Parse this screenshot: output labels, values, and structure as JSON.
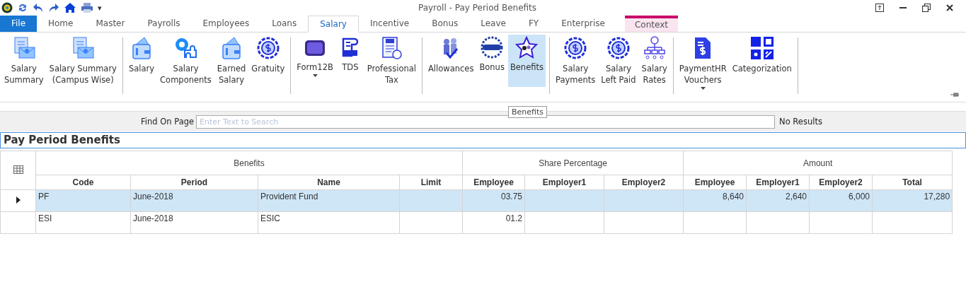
{
  "window": {
    "title": "Payroll - Pay Period Benefits",
    "quick_access_more": "▾"
  },
  "tabs": [
    {
      "label": "File",
      "kind": "file",
      "selected": false
    },
    {
      "label": "Home",
      "kind": "tab",
      "selected": false
    },
    {
      "label": "Master",
      "kind": "tab",
      "selected": false
    },
    {
      "label": "Payrolls",
      "kind": "tab",
      "selected": false
    },
    {
      "label": "Employees",
      "kind": "tab",
      "selected": false
    },
    {
      "label": "Loans",
      "kind": "tab",
      "selected": false
    },
    {
      "label": "Salary",
      "kind": "tab",
      "selected": true
    },
    {
      "label": "Incentive",
      "kind": "tab",
      "selected": false
    },
    {
      "label": "Bonus",
      "kind": "tab",
      "selected": false
    },
    {
      "label": "Leave",
      "kind": "tab",
      "selected": false
    },
    {
      "label": "FY",
      "kind": "tab",
      "selected": false
    },
    {
      "label": "Enterprise",
      "kind": "tab",
      "selected": false
    },
    {
      "label": "Context",
      "kind": "context",
      "selected": false
    }
  ],
  "ribbon_groups": [
    {
      "items": [
        {
          "lines": [
            "Salary",
            "Summary"
          ],
          "kind": "docmail",
          "selected": false,
          "dropdown": false
        },
        {
          "lines": [
            "Salary Summary",
            "(Campus Wise)"
          ],
          "kind": "docmail",
          "selected": false,
          "dropdown": false
        }
      ]
    },
    {
      "items": [
        {
          "lines": [
            "Salary"
          ],
          "kind": "wallet",
          "selected": false,
          "dropdown": false
        },
        {
          "lines": [
            "Salary",
            "Components"
          ],
          "kind": "gear",
          "selected": false,
          "dropdown": false
        },
        {
          "lines": [
            "Earned",
            "Salary"
          ],
          "kind": "wallet",
          "selected": false,
          "dropdown": false
        },
        {
          "lines": [
            "Gratuity"
          ],
          "kind": "money",
          "selected": false,
          "dropdown": false
        }
      ]
    },
    {
      "items": [
        {
          "lines": [
            "Form12B"
          ],
          "kind": "badge",
          "selected": false,
          "dropdown": true
        },
        {
          "lines": [
            "TDS"
          ],
          "kind": "tds",
          "selected": false,
          "dropdown": false
        },
        {
          "lines": [
            "Professional",
            "Tax"
          ],
          "kind": "taxdoc",
          "selected": false,
          "dropdown": false
        }
      ]
    },
    {
      "items": [
        {
          "lines": [
            "Allowances"
          ],
          "kind": "people",
          "selected": false,
          "dropdown": false
        },
        {
          "lines": [
            "Bonus"
          ],
          "kind": "bonus",
          "selected": false,
          "dropdown": false
        },
        {
          "lines": [
            "Benefits"
          ],
          "kind": "star",
          "selected": true,
          "dropdown": false
        }
      ]
    },
    {
      "items": [
        {
          "lines": [
            "Salary",
            "Payments"
          ],
          "kind": "money",
          "selected": false,
          "dropdown": false
        },
        {
          "lines": [
            "Salary",
            "Left Paid"
          ],
          "kind": "money",
          "selected": false,
          "dropdown": false
        },
        {
          "lines": [
            "Salary",
            "Rates"
          ],
          "kind": "org",
          "selected": false,
          "dropdown": false
        }
      ]
    },
    {
      "items": [
        {
          "lines": [
            "PaymentHR",
            "Vouchers"
          ],
          "kind": "invoice",
          "selected": false,
          "dropdown": true
        },
        {
          "lines": [
            "Categorization"
          ],
          "kind": "blocks",
          "selected": false,
          "dropdown": false
        }
      ]
    }
  ],
  "tooltip": "Benefits",
  "find": {
    "label": "Find On Page",
    "placeholder": "Enter Text to Search",
    "result": "No Results"
  },
  "page_title": "Pay Period Benefits",
  "table": {
    "bands": [
      {
        "label": "Benefits"
      },
      {
        "label": "Share Percentage"
      },
      {
        "label": "Amount"
      }
    ],
    "columns": [
      "Code",
      "Period",
      "Name",
      "Limit",
      "Employee",
      "Employer1",
      "Employer2",
      "Employee",
      "Employer1",
      "Employer2",
      "Total"
    ],
    "rows": [
      {
        "selected": true,
        "cells": [
          "PF",
          "June-2018",
          "Provident Fund",
          "",
          "03.75",
          "",
          "",
          "8,640",
          "2,640",
          "6,000",
          "17,280"
        ]
      },
      {
        "selected": false,
        "cells": [
          "ESI",
          "June-2018",
          "ESIC",
          "",
          "01.2",
          "",
          "",
          "",
          "",
          "",
          ""
        ]
      }
    ]
  }
}
